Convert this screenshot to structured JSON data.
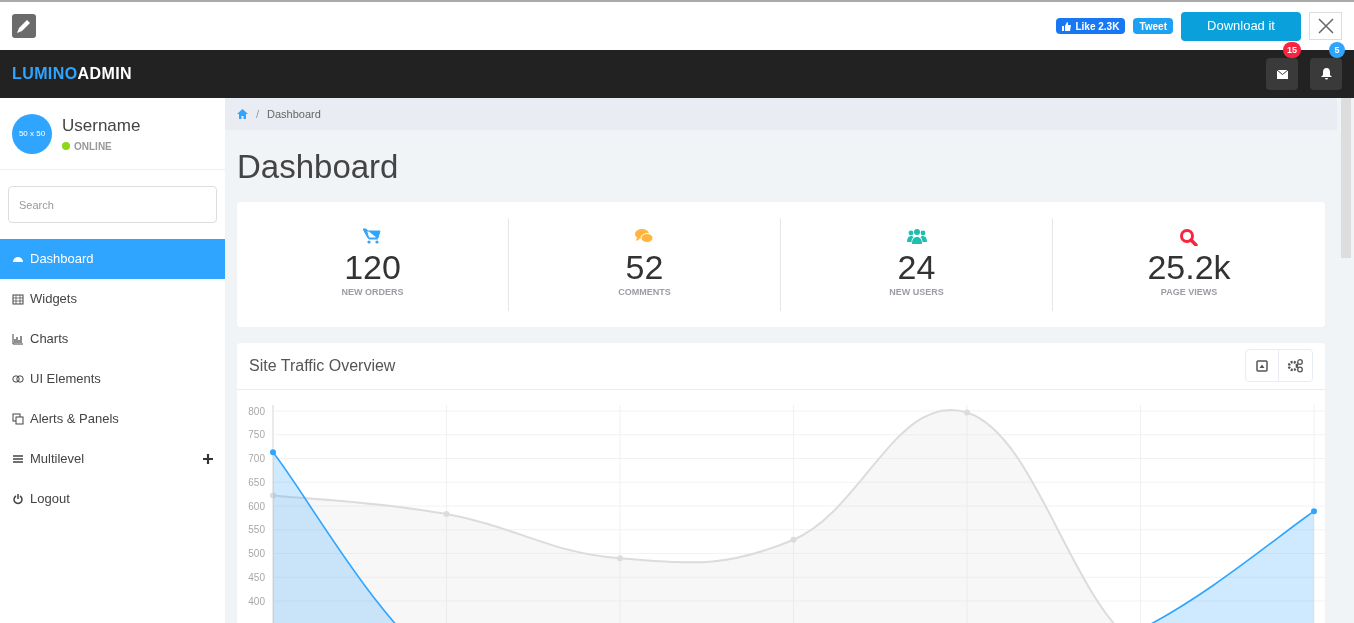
{
  "topbar": {
    "like": "Like 2.3K",
    "tweet": "Tweet",
    "download": "Download it"
  },
  "navbar": {
    "brand_part_1": "LUMINO",
    "brand_part_2": "ADMIN",
    "messages_count": "15",
    "alerts_count": "5"
  },
  "profile": {
    "avatar_text": "50 x 50",
    "name": "Username",
    "status": "ONLINE",
    "color": "#8ad919"
  },
  "search": {
    "placeholder": "Search"
  },
  "sidebar": {
    "items": [
      {
        "label": "Dashboard",
        "selected": true,
        "expandable": false
      },
      {
        "label": "Widgets",
        "selected": false,
        "expandable": false
      },
      {
        "label": "Charts",
        "selected": false,
        "expandable": false
      },
      {
        "label": "UI Elements",
        "selected": false,
        "expandable": false
      },
      {
        "label": "Alerts & Panels",
        "selected": false,
        "expandable": false
      },
      {
        "label": "Multilevel",
        "selected": false,
        "expandable": true
      },
      {
        "label": "Logout",
        "selected": false,
        "expandable": false
      }
    ]
  },
  "breadcrumb": {
    "separator": "/",
    "items": [
      "Dashboard"
    ]
  },
  "page_title": "Dashboard",
  "stats": [
    {
      "color": "#30a5ff",
      "value": "120",
      "label": "NEW ORDERS"
    },
    {
      "color": "#ffb53e",
      "value": "52",
      "label": "COMMENTS"
    },
    {
      "color": "#1ebfae",
      "value": "24",
      "label": "NEW USERS"
    },
    {
      "color": "#f9243f",
      "value": "25.2k",
      "label": "PAGE VIEWS"
    }
  ],
  "traffic_panel": {
    "title": "Site Traffic Overview",
    "y_axis_labels": [
      "800",
      "750",
      "700",
      "650",
      "600",
      "550",
      "500",
      "450",
      "400"
    ]
  }
}
